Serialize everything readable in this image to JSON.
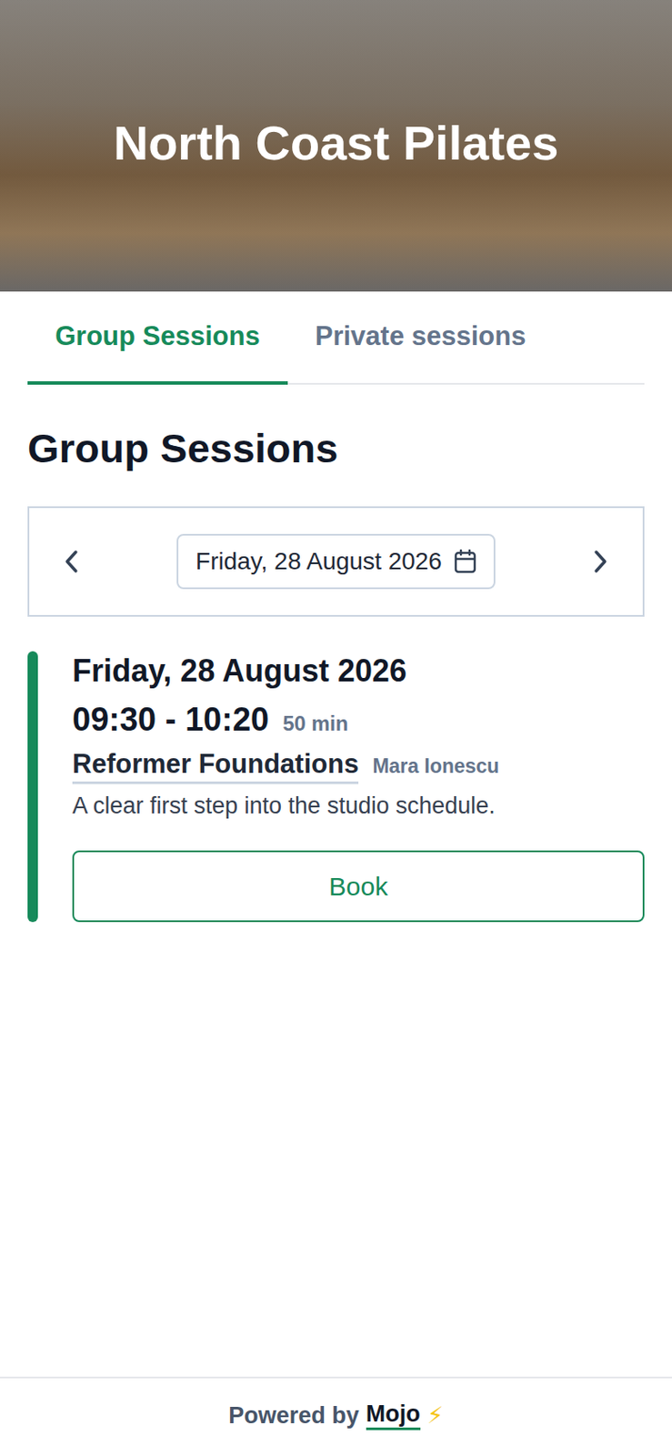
{
  "header": {
    "title": "North Coast Pilates"
  },
  "tabs": [
    {
      "label": "Group Sessions",
      "selected": true
    },
    {
      "label": "Private sessions",
      "selected": false
    }
  ],
  "heading": "Group Sessions",
  "date_picker": {
    "value": "Friday, 28 August 2026"
  },
  "sessions": [
    {
      "date": "Friday, 28 August 2026",
      "time": "09:30 - 10:20",
      "duration": "50 min",
      "name": "Reformer Foundations",
      "instructor": "Mara Ionescu",
      "description": "A clear first step into the studio schedule.",
      "button": "Book",
      "color": "#168a5a"
    }
  ],
  "footer": {
    "prefix": "Powered by",
    "brand": "Mojo",
    "icon": "⚡"
  }
}
